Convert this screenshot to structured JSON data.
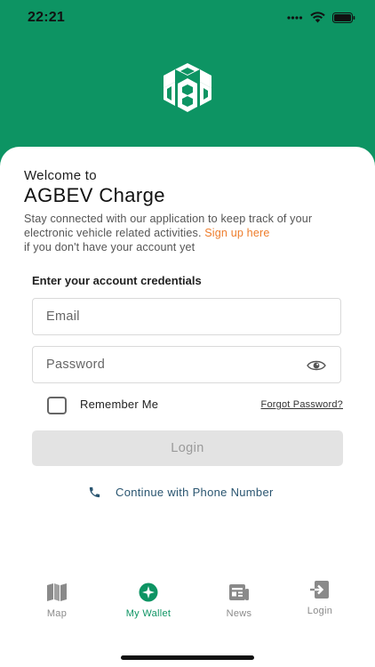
{
  "status_bar": {
    "time": "22:21"
  },
  "welcome": {
    "prefix": "Welcome to",
    "app_name": "AGBEV Charge",
    "intro_text": "Stay connected with our application to keep track of your electronic vehicle related activities.",
    "signup_link": "Sign up here",
    "intro_suffix": "if you don't have your account yet"
  },
  "form": {
    "title": "Enter your account credentials",
    "email_placeholder": "Email",
    "password_placeholder": "Password",
    "remember_label": "Remember Me",
    "remember_checked": false,
    "forgot_label": "Forgot Password?",
    "login_label": "Login",
    "phone_label": "Continue with Phone Number"
  },
  "tabs": [
    {
      "label": "Map",
      "icon": "map-icon",
      "active": false
    },
    {
      "label": "My Wallet",
      "icon": "wallet-icon",
      "active": true
    },
    {
      "label": "News",
      "icon": "news-icon",
      "active": false
    },
    {
      "label": "Login",
      "icon": "login-icon",
      "active": false
    }
  ],
  "colors": {
    "brand_green": "#0d9463",
    "link_orange": "#ee7d2c",
    "phone_text": "#2a5570"
  }
}
